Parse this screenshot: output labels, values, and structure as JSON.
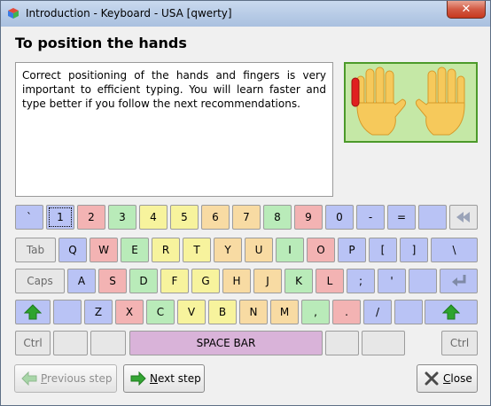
{
  "window": {
    "title": "Introduction - Keyboard - USA [qwerty]",
    "close_label": "✕"
  },
  "heading": "To position the hands",
  "body_text": "Correct positioning of the hands and fingers is very important to efficient typing. You will learn faster and type better if you follow the next recommendations.",
  "colors": {
    "pinky": "#b9c3f5",
    "ring": "#f3b3b3",
    "middle": "#b9ebb9",
    "index_left": "#f7f39d",
    "index_right": "#f8dba3",
    "special": "#e7e7e7",
    "space": "#d9b3d9",
    "green_arrow": "#2ea42e",
    "hands_bg": "#c5e8a6"
  },
  "keyboard": {
    "row1": [
      "`",
      "1",
      "2",
      "3",
      "4",
      "5",
      "6",
      "7",
      "8",
      "9",
      "0",
      "-",
      "=",
      "",
      ""
    ],
    "row2": [
      "Tab",
      "Q",
      "W",
      "E",
      "R",
      "T",
      "Y",
      "U",
      "I",
      "O",
      "P",
      "[",
      "]",
      "\\"
    ],
    "row3": [
      "Caps",
      "A",
      "S",
      "D",
      "F",
      "G",
      "H",
      "J",
      "K",
      "L",
      ";",
      "'",
      "",
      ""
    ],
    "row4": [
      "",
      "",
      "Z",
      "X",
      "C",
      "V",
      "B",
      "N",
      "M",
      ",",
      ".",
      "/",
      "",
      ""
    ],
    "row5": [
      "Ctrl",
      "",
      "",
      "SPACE BAR",
      "",
      "",
      "Ctrl"
    ],
    "backspace_icon": "backspace-icon",
    "enter_icon": "enter-icon",
    "shift_icon": "shift-arrow-icon"
  },
  "buttons": {
    "previous_prefix": "",
    "previous_u": "P",
    "previous_rest": "revious step",
    "next_u": "N",
    "next_rest": "ext step",
    "close_u": "C",
    "close_rest": "lose"
  }
}
